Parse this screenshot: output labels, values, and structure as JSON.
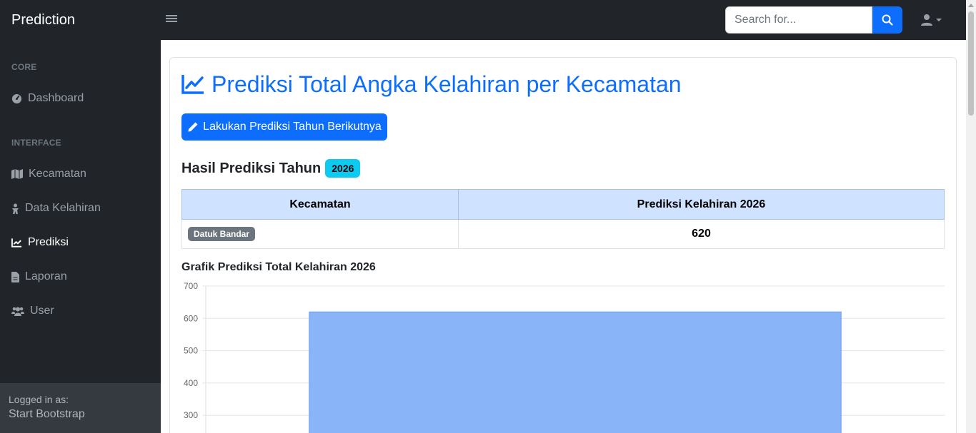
{
  "topnav": {
    "brand": "Prediction",
    "search_placeholder": "Search for..."
  },
  "sidebar": {
    "core_heading": "CORE",
    "interface_heading": "INTERFACE",
    "items": [
      {
        "label": "Dashboard",
        "icon": "gauge-icon"
      },
      {
        "label": "Kecamatan",
        "icon": "map-icon"
      },
      {
        "label": "Data Kelahiran",
        "icon": "baby-icon"
      },
      {
        "label": "Prediksi",
        "icon": "chart-line-icon",
        "active": true
      },
      {
        "label": "Laporan",
        "icon": "file-icon"
      },
      {
        "label": "User",
        "icon": "users-icon"
      }
    ],
    "footer": {
      "logged_label": "Logged in as:",
      "user_name": "Start Bootstrap"
    }
  },
  "main": {
    "title": "Prediksi Total Angka Kelahiran per Kecamatan",
    "predict_button": "Lakukan Prediksi Tahun Berikutnya",
    "result_heading": "Hasil Prediksi Tahun",
    "result_year": "2026",
    "table": {
      "headers": [
        "Kecamatan",
        "Prediksi Kelahiran 2026"
      ],
      "rows": [
        {
          "kecamatan": "Datuk Bandar",
          "prediksi": "620"
        }
      ]
    },
    "chart_heading": "Grafik Prediksi Total Kelahiran 2026"
  },
  "colors": {
    "primary": "#0d6efd",
    "bar_fill": "#8ab4f8",
    "sidebar_bg": "#212529"
  },
  "chart_data": {
    "type": "bar",
    "categories": [
      "Datuk Bandar"
    ],
    "values": [
      620
    ],
    "title": "Grafik Prediksi Total Kelahiran 2026",
    "xlabel": "",
    "ylabel": "",
    "y_ticks_visible": [
      700,
      600,
      500,
      400,
      300
    ],
    "ylim": [
      0,
      700
    ],
    "grid": true
  }
}
